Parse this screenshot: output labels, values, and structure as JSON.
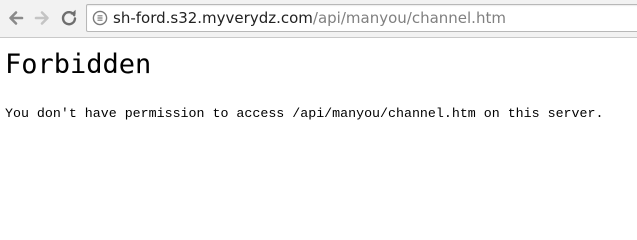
{
  "browser": {
    "url_host": "sh-ford.s32.myverydz.com",
    "url_path": "/api/manyou/channel.htm",
    "icons": {
      "back": "arrow-left-icon",
      "forward": "arrow-right-icon",
      "reload": "reload-icon",
      "page": "page-info-icon"
    }
  },
  "page": {
    "heading": "Forbidden",
    "message": "You don't have permission to access /api/manyou/channel.htm on this server."
  }
}
